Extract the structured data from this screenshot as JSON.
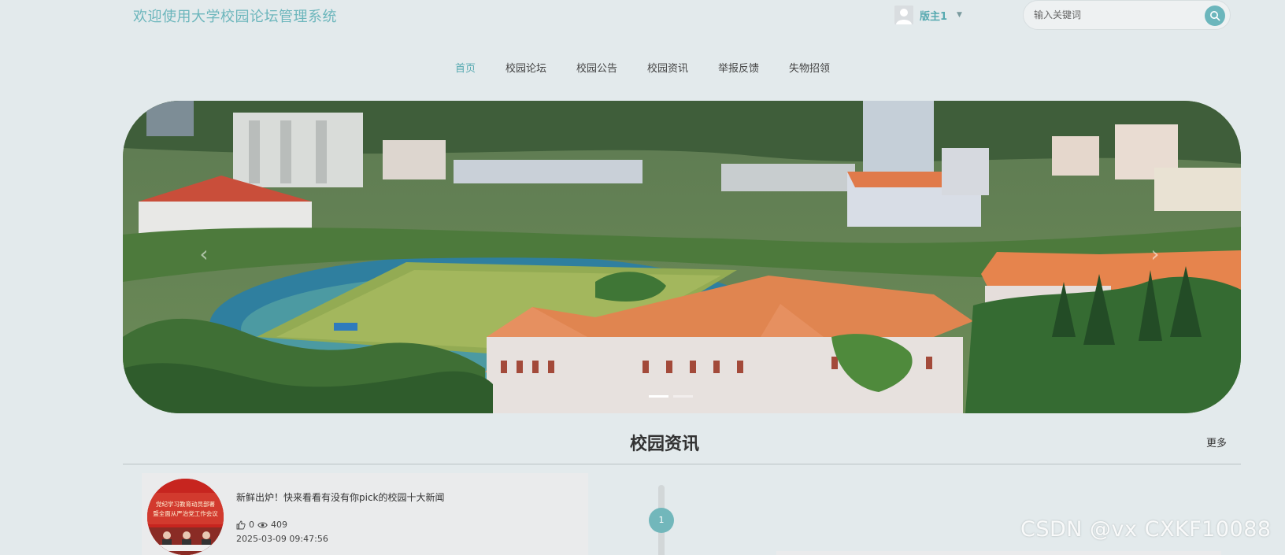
{
  "header": {
    "site_title": "欢迎使用大学校园论坛管理系统",
    "user_name": "版主1",
    "search_placeholder": "输入关键词"
  },
  "nav": {
    "items": [
      {
        "label": "首页",
        "active": true
      },
      {
        "label": "校园论坛",
        "active": false
      },
      {
        "label": "校园公告",
        "active": false
      },
      {
        "label": "校园资讯",
        "active": false
      },
      {
        "label": "举报反馈",
        "active": false
      },
      {
        "label": "失物招领",
        "active": false
      }
    ]
  },
  "banner": {
    "slide_count": 2,
    "active_slide": 1
  },
  "section": {
    "title": "校园资讯",
    "more_label": "更多"
  },
  "news": [
    {
      "thumb_text": "党纪学习教育动员部署暨全面从严治党工作会议",
      "title": "新鲜出炉！快来看看有没有你pick的校园十大新闻",
      "likes": "0",
      "views": "409",
      "time": "2025-03-09 09:47:56"
    }
  ],
  "timeline": {
    "current": "1"
  },
  "watermark": "CSDN @vx  CXKF10088",
  "colors": {
    "accent": "#6cb6bc",
    "background": "#e3eaec"
  }
}
